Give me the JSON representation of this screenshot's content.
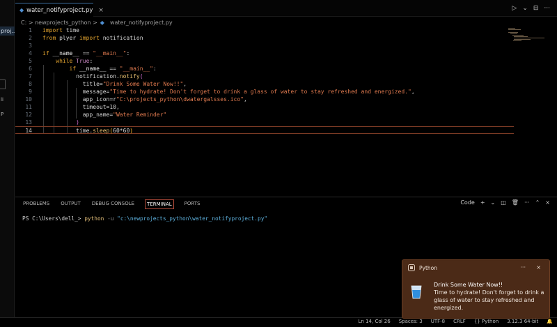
{
  "sidebar": {
    "file_snippet": "proj...",
    "glyph_1": "li",
    "glyph_2": "P"
  },
  "tab": {
    "filename": "water_notifyproject.py",
    "close": "×"
  },
  "tab_actions": {
    "run": "▷",
    "run_menu": "⌄",
    "split": "⊟",
    "more": "···"
  },
  "breadcrumb": {
    "path": "C: > newprojects_python >",
    "file": "water_notifyproject.py"
  },
  "editor": {
    "line_numbers": [
      "1",
      "2",
      "3",
      "4",
      "5",
      "6",
      "7",
      "8",
      "9",
      "10",
      "11",
      "12",
      "13",
      "14"
    ],
    "lines": [
      [
        {
          "t": "import",
          "c": "kw"
        },
        {
          "t": " time",
          "c": "nm"
        }
      ],
      [
        {
          "t": "from",
          "c": "kw"
        },
        {
          "t": " plyer ",
          "c": "nm"
        },
        {
          "t": "import",
          "c": "kw"
        },
        {
          "t": " notification",
          "c": "nm"
        }
      ],
      [],
      [
        {
          "t": "if",
          "c": "kw"
        },
        {
          "t": " __name__ ",
          "c": "id"
        },
        {
          "t": "==",
          "c": "op"
        },
        {
          "t": " \"__main__\"",
          "c": "st"
        },
        {
          "t": ":",
          "c": "op"
        }
      ],
      [
        {
          "t": "    while",
          "c": "kw"
        },
        {
          "t": " True",
          "c": "kc"
        },
        {
          "t": ":",
          "c": "op"
        }
      ],
      [
        {
          "t": "        if",
          "c": "kw"
        },
        {
          "t": " __name__ ",
          "c": "id"
        },
        {
          "t": "==",
          "c": "op"
        },
        {
          "t": " \"__main__\"",
          "c": "st"
        },
        {
          "t": ":",
          "c": "op"
        }
      ],
      [
        {
          "t": "          notification.",
          "c": "nm"
        },
        {
          "t": "notify",
          "c": "fn"
        },
        {
          "t": "(",
          "c": "pr2"
        }
      ],
      [
        {
          "t": "            title=",
          "c": "nm"
        },
        {
          "t": "\"Drink Some Water Now!!\"",
          "c": "st"
        },
        {
          "t": ",",
          "c": "op"
        }
      ],
      [
        {
          "t": "            message=",
          "c": "nm"
        },
        {
          "t": "\"Time to hydrate! Don't forget to drink a glass of water to stay refreshed and energized.\"",
          "c": "st"
        },
        {
          "t": ",",
          "c": "op"
        }
      ],
      [
        {
          "t": "            app_icon=r",
          "c": "nm"
        },
        {
          "t": "\"C:\\projects_python\\dwatergalsses.ico\"",
          "c": "st"
        },
        {
          "t": ",",
          "c": "op"
        }
      ],
      [
        {
          "t": "            timeout=",
          "c": "nm"
        },
        {
          "t": "10",
          "c": "nm"
        },
        {
          "t": ",",
          "c": "op"
        }
      ],
      [
        {
          "t": "            app_name=",
          "c": "nm"
        },
        {
          "t": "\"Water Reminder\"",
          "c": "st"
        }
      ],
      [
        {
          "t": "          )",
          "c": "pr2"
        }
      ],
      [
        {
          "t": "          time.",
          "c": "nm"
        },
        {
          "t": "sleep",
          "c": "fn"
        },
        {
          "t": "(",
          "c": "pr"
        },
        {
          "t": "60*60",
          "c": "nm"
        },
        {
          "t": ")",
          "c": "pr"
        }
      ]
    ]
  },
  "panel": {
    "tabs": [
      "PROBLEMS",
      "OUTPUT",
      "DEBUG CONSOLE",
      "TERMINAL",
      "PORTS"
    ],
    "active_tab": "TERMINAL",
    "tools": {
      "shell": "Code",
      "add": "+",
      "chev": "⌄",
      "split": "◫",
      "trash": "🗑",
      "more": "···",
      "up": "⌃",
      "close": "×"
    }
  },
  "terminal": {
    "prompt": "PS C:\\Users\\dell_> ",
    "cmd": "python",
    "flag": " -u ",
    "path": "\"c:\\newprojects_python\\water_notifyproject.py\""
  },
  "statusbar": {
    "cursor": "Ln 14, Col 26",
    "spaces": "Spaces: 3",
    "encoding": "UTF-8",
    "eol": "CRLF",
    "lang": "{} Python",
    "version": "3.12.3 64-bit",
    "bell": "🔔"
  },
  "notification": {
    "app": "Python",
    "more": "···",
    "close": "×",
    "title": "Drink Some Water Now!!",
    "message": "Time to hydrate! Don't forget to drink a glass of water to stay refreshed and energized."
  },
  "colors": {
    "accent": "#3c6e9f",
    "toast_bg": "#4b2a17",
    "string": "#e07a4f",
    "keyword": "#e2a32e"
  }
}
